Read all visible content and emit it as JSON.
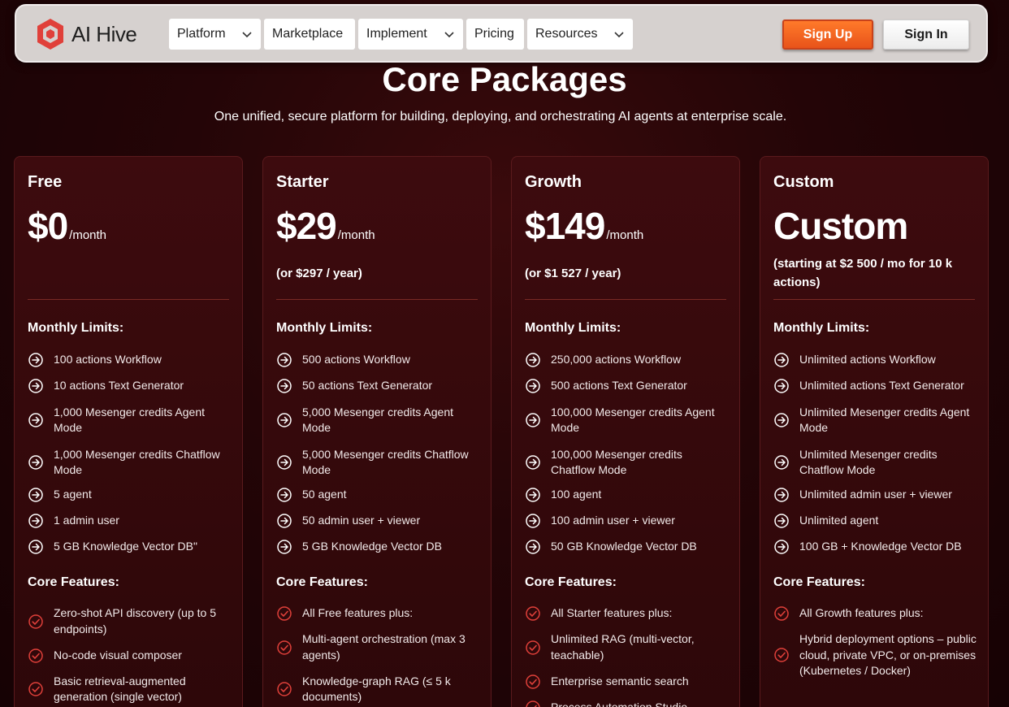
{
  "nav": {
    "logo_text": "AI Hive",
    "menu": [
      {
        "label": "Platform",
        "dropdown": true
      },
      {
        "label": "Marketplace",
        "dropdown": false
      },
      {
        "label": "Implement",
        "dropdown": true
      },
      {
        "label": "Pricing",
        "dropdown": false
      },
      {
        "label": "Resources",
        "dropdown": true
      }
    ],
    "signup_label": "Sign Up",
    "signin_label": "Sign In"
  },
  "hero": {
    "title": "Core Packages",
    "subtitle": "One unified, secure platform for building, deploying, and orchestrating AI agents at enterprise scale."
  },
  "plans": [
    {
      "name": "Free",
      "price": "$0",
      "per": "/month",
      "annual": "",
      "limits_title": "Monthly Limits:",
      "limits": [
        "100 actions Workflow",
        "10 actions Text Generator",
        "1,000 Mesenger credits Agent Mode",
        "1,000 Mesenger credits Chatflow Mode",
        "5 agent",
        "1 admin user",
        "5 GB Knowledge Vector DB\""
      ],
      "features_title": "Core Features:",
      "features": [
        "Zero-shot API discovery (up to 5 endpoints)",
        "No-code visual composer",
        "Basic retrieval-augmented generation (single vector)"
      ]
    },
    {
      "name": "Starter",
      "price": "$29",
      "per": "/month",
      "annual": "(or $297 / year)",
      "limits_title": "Monthly Limits:",
      "limits": [
        "500 actions Workflow",
        "50 actions Text Generator",
        "5,000 Mesenger credits Agent Mode",
        "5,000 Mesenger credits Chatflow Mode",
        "50 agent",
        "50 admin user + viewer",
        "5 GB Knowledge Vector DB"
      ],
      "features_title": "Core Features:",
      "features": [
        "All Free features plus:",
        "Multi-agent orchestration (max 3 agents)",
        "Knowledge-graph RAG (≤ 5 k documents)"
      ]
    },
    {
      "name": "Growth",
      "price": "$149",
      "per": "/month",
      "annual": "(or $1 527 / year)",
      "limits_title": "Monthly Limits:",
      "limits": [
        "250,000 actions Workflow",
        "500 actions Text Generator",
        "100,000 Mesenger credits Agent Mode",
        "100,000 Mesenger credits Chatflow Mode",
        "100 agent",
        "100 admin user + viewer",
        "50 GB Knowledge Vector DB"
      ],
      "features_title": "Core Features:",
      "features": [
        "All Starter features plus:",
        "Unlimited RAG (multi-vector, teachable)",
        "Enterprise semantic search",
        "Process Automation Studio"
      ]
    },
    {
      "name": "Custom",
      "price": "Custom",
      "per": "",
      "annual": "(starting at $2 500 / mo for 10 k actions)",
      "limits_title": "Monthly Limits:",
      "limits": [
        "Unlimited actions Workflow",
        "Unlimited actions Text Generator",
        "Unlimited Mesenger credits Agent Mode",
        "Unlimited Mesenger credits Chatflow Mode",
        "Unlimited admin user + viewer",
        "Unlimited agent",
        "100 GB + Knowledge Vector DB"
      ],
      "features_title": "Core Features:",
      "features": [
        "All Growth features plus:",
        "Hybrid deployment options – public cloud, private VPC, or on-premises (Kubernetes / Docker)"
      ]
    }
  ],
  "colors": {
    "background": "#240507",
    "card": "#3d0b0e",
    "accent_orange": "#f0621f",
    "check_red": "#e0403a",
    "nav_bg": "#d6d1cf"
  }
}
